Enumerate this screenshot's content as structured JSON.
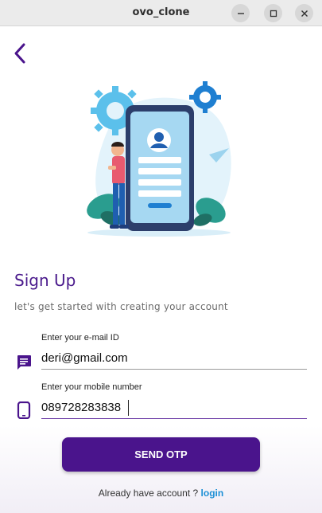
{
  "window": {
    "title": "ovo_clone",
    "icons": [
      "minimize-icon",
      "maximize-icon",
      "close-icon"
    ]
  },
  "header": {
    "back_icon": "chevron-left-icon"
  },
  "form": {
    "title": "Sign Up",
    "subtitle": "let's get started with creating your account",
    "email": {
      "label": "Enter your e-mail ID",
      "value": "deri@gmail.com",
      "icon": "message-icon"
    },
    "phone": {
      "label": "Enter your mobile number",
      "value": "089728283838",
      "icon": "smartphone-icon"
    },
    "submit_label": "SEND OTP"
  },
  "footer": {
    "prompt": "Already have account ? ",
    "login_label": "login"
  },
  "colors": {
    "primary": "#4a148c",
    "heading": "#4a1a8c",
    "link": "#1b8fd6",
    "illustration_blue": "#5bc0eb",
    "illustration_teal": "#2a9d8f"
  }
}
